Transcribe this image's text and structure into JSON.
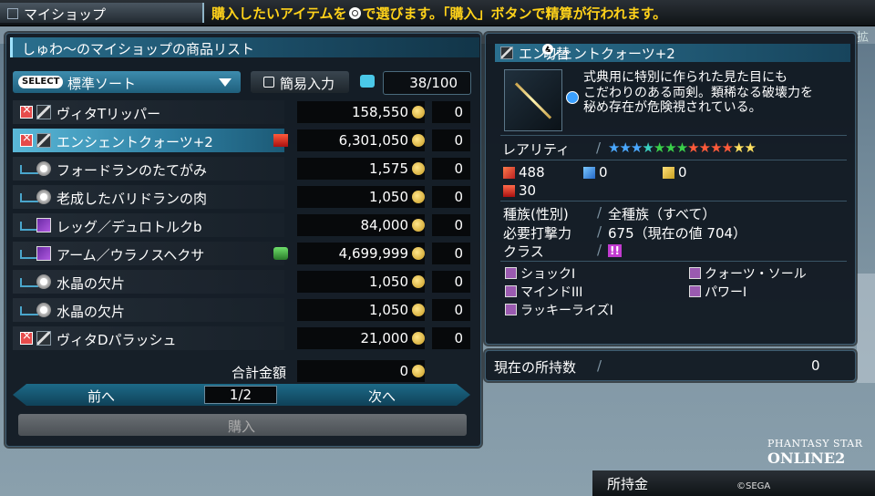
{
  "topbar": {
    "title": "マイショップ",
    "hint_pre": "購入したいアイテムを",
    "hint_post": "で選びます。「購入」ボタンで精算が行われます。"
  },
  "list_panel": {
    "title": "しゅわ〜のマイショップの商品リスト",
    "select_badge": "SELECT",
    "sort_label": "標準ソート",
    "quick_input": "簡易入力",
    "capacity": "38/100",
    "items": [
      {
        "name": "ヴィタTリッパー",
        "price": "158,550",
        "qty": "0",
        "icon1": "unusable-x-icon",
        "icon2": "sword-icon",
        "tag": ""
      },
      {
        "name": "エンシェントクォーツ+2",
        "price": "6,301,050",
        "qty": "0",
        "icon1": "unusable-x-icon",
        "icon2": "sword-icon",
        "tag": "crown-icon",
        "selected": true
      },
      {
        "name": "フォードランのたてがみ",
        "price": "1,575",
        "qty": "0",
        "icon1": "arrow-icon",
        "icon2": "material-icon",
        "tag": ""
      },
      {
        "name": "老成したバリドランの肉",
        "price": "1,050",
        "qty": "0",
        "icon1": "arrow-icon",
        "icon2": "material-icon",
        "tag": ""
      },
      {
        "name": "レッグ／デュロトルクb",
        "price": "84,000",
        "qty": "0",
        "icon1": "arrow-icon",
        "icon2": "leg-part-icon",
        "tag": ""
      },
      {
        "name": "アーム／ウラノスヘクサ",
        "price": "4,699,999",
        "qty": "0",
        "icon1": "arrow-icon",
        "icon2": "arm-part-icon",
        "tag": "affix-icon"
      },
      {
        "name": "水晶の欠片",
        "price": "1,050",
        "qty": "0",
        "icon1": "arrow-icon",
        "icon2": "material-icon",
        "tag": ""
      },
      {
        "name": "水晶の欠片",
        "price": "1,050",
        "qty": "0",
        "icon1": "arrow-icon",
        "icon2": "material-icon",
        "tag": ""
      },
      {
        "name": "ヴィタDパラッシュ",
        "price": "21,000",
        "qty": "0",
        "icon1": "unusable-x-icon",
        "icon2": "sword-icon",
        "tag": ""
      }
    ],
    "total_label": "合計金額",
    "total_value": "0",
    "prev": "前へ",
    "page": "1/2",
    "next": "次へ",
    "buy": "購入"
  },
  "detail": {
    "name": "エンシェントクォーツ+2",
    "switch_label": "切替",
    "description": [
      "式典用に特別に作られた見た目にも",
      "こだわりのある両剣。類稀なる破壊力を",
      "秘め存在が危険視されている。"
    ],
    "rarity_label": "レアリティ",
    "rarity_stars": 13,
    "atk": "488",
    "rng": "0",
    "tec": "0",
    "element": "30",
    "race_label": "種族(性別)",
    "race_value": "全種族（すべて）",
    "req_label": "必要打撃力",
    "req_value": "675（現在の値 704）",
    "class_label": "クラス",
    "class_value": "!!",
    "abilities": [
      "ショックI",
      "クォーツ・ソール",
      "マインドIII",
      "パワーI",
      "ラッキーライズI"
    ]
  },
  "owned": {
    "label": "現在の所持数",
    "value": "0"
  },
  "footer": {
    "money_label": "所持金",
    "sega": "©SEGA",
    "logo_top": "PHANTASY STAR",
    "logo_bottom": "ONLINE2",
    "partial_right": "拡"
  }
}
